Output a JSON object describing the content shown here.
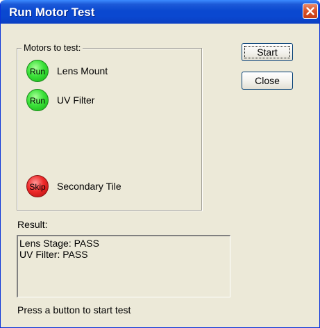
{
  "window": {
    "title": "Run Motor Test"
  },
  "motors_group": {
    "title": "Motors to test:",
    "motors": [
      {
        "button_label": "Run",
        "name": "Lens Mount",
        "state": "run",
        "color": "#22cc22"
      },
      {
        "button_label": "Run",
        "name": "UV Filter",
        "state": "run",
        "color": "#22cc22"
      },
      {
        "button_label": "Skip",
        "name": "Secondary Tile",
        "state": "skip",
        "color": "#dd2222"
      }
    ]
  },
  "buttons": {
    "start_label": "Start",
    "close_label": "Close"
  },
  "result": {
    "label": "Result:",
    "lines": [
      "Lens Stage: PASS",
      "UV Filter: PASS"
    ]
  },
  "status": "Press a button to start test",
  "icons": {
    "close": "close-x-icon"
  }
}
